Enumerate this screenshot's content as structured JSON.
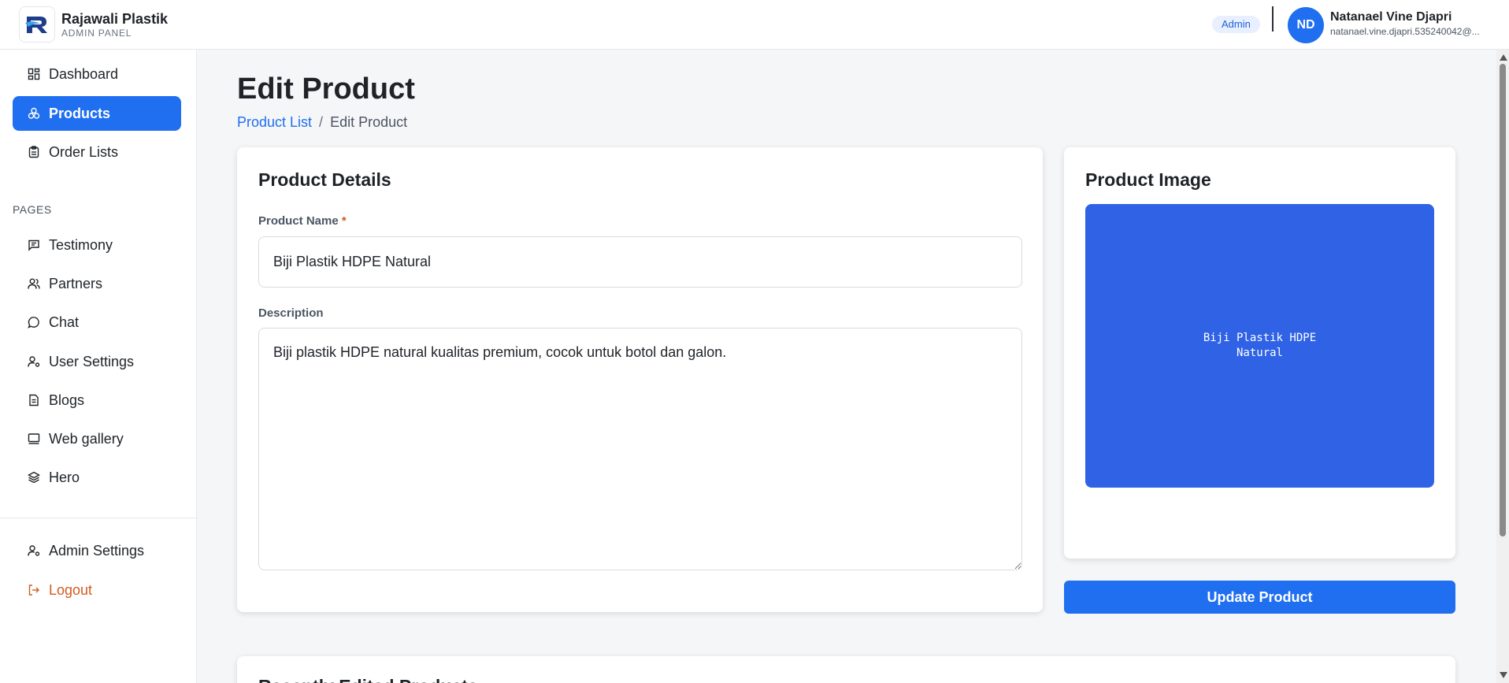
{
  "brand": {
    "name": "Rajawali Plastik",
    "subtitle": "ADMIN PANEL"
  },
  "header": {
    "role_badge": "Admin",
    "avatar_initials": "ND",
    "user_name": "Natanael Vine Djapri",
    "user_email": "natanael.vine.djapri.535240042@..."
  },
  "sidebar": {
    "main_items": [
      {
        "label": "Dashboard",
        "icon": "dashboard-icon"
      },
      {
        "label": "Products",
        "icon": "products-icon",
        "active": true
      },
      {
        "label": "Order Lists",
        "icon": "clipboard-icon"
      }
    ],
    "pages_label": "PAGES",
    "page_items": [
      {
        "label": "Testimony",
        "icon": "message-square-icon"
      },
      {
        "label": "Partners",
        "icon": "users-icon"
      },
      {
        "label": "Chat",
        "icon": "chat-bubble-icon"
      },
      {
        "label": "User Settings",
        "icon": "user-settings-icon"
      },
      {
        "label": "Blogs",
        "icon": "document-icon"
      },
      {
        "label": "Web gallery",
        "icon": "gallery-icon"
      },
      {
        "label": "Hero",
        "icon": "layers-icon"
      }
    ],
    "bottom_items": [
      {
        "label": "Admin Settings",
        "icon": "user-settings-icon"
      },
      {
        "label": "Logout",
        "icon": "logout-icon"
      }
    ]
  },
  "page": {
    "title": "Edit Product",
    "breadcrumb": {
      "link": "Product List",
      "separator": "/",
      "current": "Edit Product"
    }
  },
  "details_card": {
    "title": "Product Details",
    "name_label": "Product Name",
    "required_mark": "*",
    "name_value": "Biji Plastik HDPE Natural",
    "description_label": "Description",
    "description_value": "Biji plastik HDPE natural kualitas premium, cocok untuk botol dan galon."
  },
  "image_card": {
    "title": "Product Image",
    "image_caption": "Biji Plastik HDPE Natural"
  },
  "actions": {
    "update_label": "Update Product"
  },
  "recent_card": {
    "title": "Recently Edited Products"
  },
  "colors": {
    "primary": "#1f6ff0",
    "image_bg": "#2f62e5",
    "logout": "#d35a22"
  }
}
